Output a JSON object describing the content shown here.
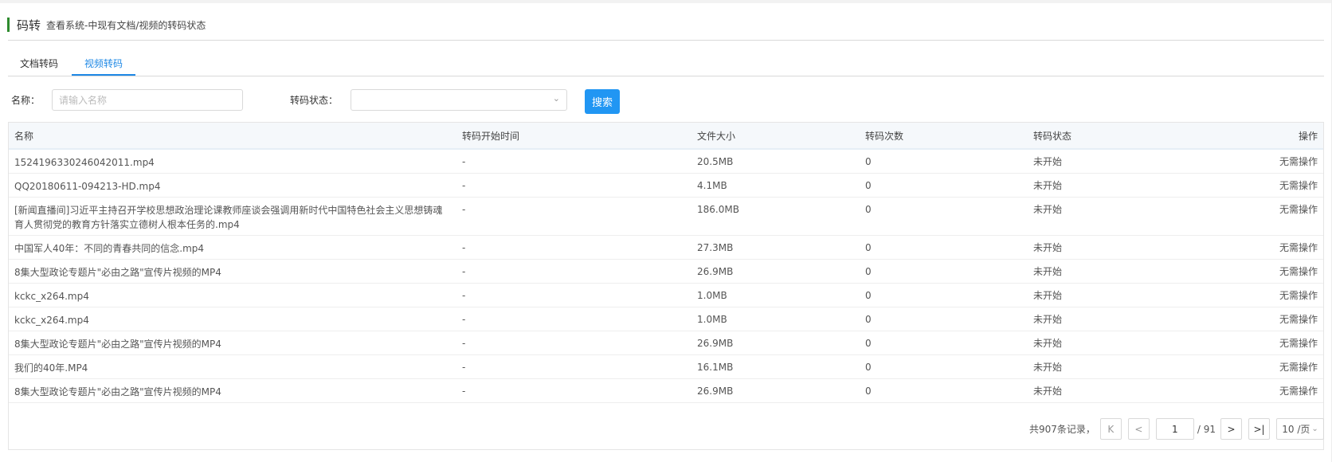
{
  "header": {
    "title": "码转",
    "subtitle": "查看系统-中现有文档/视频的转码状态"
  },
  "tabs": [
    {
      "label": "文档转码",
      "active": false
    },
    {
      "label": "视频转码",
      "active": true
    }
  ],
  "filters": {
    "name_label": "名称：",
    "name_placeholder": "请输入名称",
    "status_label": "转码状态：",
    "status_value": "",
    "search_label": "搜索"
  },
  "table": {
    "columns": [
      "名称",
      "转码开始时间",
      "文件大小",
      "转码次数",
      "转码状态",
      "操作"
    ],
    "rows": [
      {
        "name": "1524196330246042011.mp4",
        "start": "-",
        "size": "20.5MB",
        "count": "0",
        "status": "未开始",
        "op": "无需操作"
      },
      {
        "name": "QQ20180611-094213-HD.mp4",
        "start": "-",
        "size": "4.1MB",
        "count": "0",
        "status": "未开始",
        "op": "无需操作"
      },
      {
        "name": "[新闻直播间]习近平主持召开学校思想政治理论课教师座谈会强调用新时代中国特色社会主义思想铸魂育人贯彻党的教育方针落实立德树人根本任务的.mp4",
        "start": "-",
        "size": "186.0MB",
        "count": "0",
        "status": "未开始",
        "op": "无需操作"
      },
      {
        "name": "中国军人40年：不同的青春共同的信念.mp4",
        "start": "-",
        "size": "27.3MB",
        "count": "0",
        "status": "未开始",
        "op": "无需操作"
      },
      {
        "name": "8集大型政论专题片\"必由之路\"宣传片视频的MP4",
        "start": "-",
        "size": "26.9MB",
        "count": "0",
        "status": "未开始",
        "op": "无需操作"
      },
      {
        "name": "kckc_x264.mp4",
        "start": "-",
        "size": "1.0MB",
        "count": "0",
        "status": "未开始",
        "op": "无需操作"
      },
      {
        "name": "kckc_x264.mp4",
        "start": "-",
        "size": "1.0MB",
        "count": "0",
        "status": "未开始",
        "op": "无需操作"
      },
      {
        "name": "8集大型政论专题片\"必由之路\"宣传片视频的MP4",
        "start": "-",
        "size": "26.9MB",
        "count": "0",
        "status": "未开始",
        "op": "无需操作"
      },
      {
        "name": "我们的40年.MP4",
        "start": "-",
        "size": "16.1MB",
        "count": "0",
        "status": "未开始",
        "op": "无需操作"
      },
      {
        "name": "8集大型政论专题片\"必由之路\"宣传片视频的MP4",
        "start": "-",
        "size": "26.9MB",
        "count": "0",
        "status": "未开始",
        "op": "无需操作"
      }
    ]
  },
  "pagination": {
    "total_text": "共907条记录，",
    "current_page": "1",
    "total_pages_text": "/ 91",
    "page_size": "10 /页"
  }
}
